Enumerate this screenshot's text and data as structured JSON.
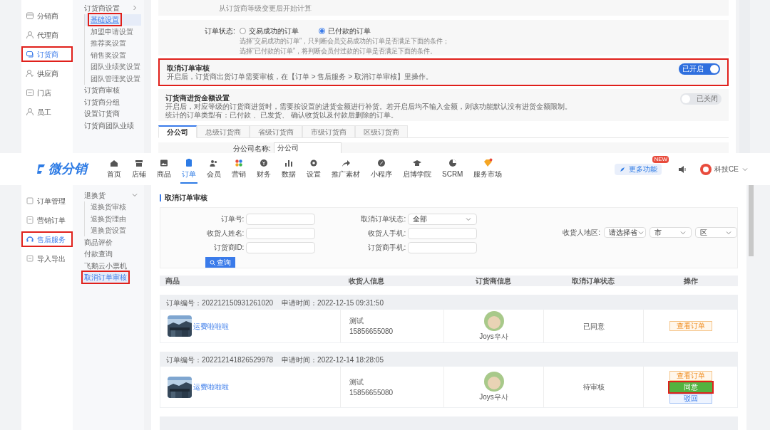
{
  "settings_page": {
    "sidebar": [
      {
        "label": "分销商",
        "selected": false,
        "highlighted": false
      },
      {
        "label": "代理商",
        "selected": false,
        "highlighted": false
      },
      {
        "label": "订货商",
        "selected": true,
        "highlighted": true
      },
      {
        "label": "供应商",
        "selected": false,
        "highlighted": false
      },
      {
        "label": "门店",
        "selected": false,
        "highlighted": false
      },
      {
        "label": "员工",
        "selected": false,
        "highlighted": false
      }
    ],
    "submenu": [
      {
        "label": "订货商设置",
        "expanded": true,
        "children": [
          {
            "label": "基础设置",
            "selected": true,
            "highlighted": true
          },
          {
            "label": "加盟申请设置",
            "selected": false,
            "highlighted": false
          },
          {
            "label": "推荐奖设置",
            "selected": false,
            "highlighted": false
          },
          {
            "label": "销售奖设置",
            "selected": false,
            "highlighted": false
          },
          {
            "label": "团队业绩奖设置",
            "selected": false,
            "highlighted": false
          },
          {
            "label": "团队管理奖设置",
            "selected": false,
            "highlighted": false
          }
        ]
      },
      {
        "label": "订货商审核"
      },
      {
        "label": "订货商分组"
      },
      {
        "label": "设置订货商"
      },
      {
        "label": "订货商团队业绩"
      }
    ],
    "note": "从订货商等级变更后开始计算",
    "order_status": {
      "label": "订单状态:",
      "options": [
        {
          "label": "交易成功的订单",
          "selected": false
        },
        {
          "label": "已付款的订单",
          "selected": true
        }
      ],
      "hints": [
        "选择“交易成功的订单”，只判断会员交易成功的订单是否满足下面的条件；",
        "选择“已付款的订单”，将判断会员付过款的订单是否满足下面的条件。"
      ]
    },
    "toggles": [
      {
        "title": "取消订单审核",
        "description": [
          "开启后，订货商出货订单需要审核，在【订单 > 售后服务 > 取消订单审核】里操作。"
        ],
        "on": true,
        "state_label": "已开启",
        "highlighted": true
      },
      {
        "title": "订货商进货金额设置",
        "description": [
          "开启后，对应等级的订货商进货时，需要按设置的进货金额进行补货。若开启后均不输入金额，则该功能默认没有进货金额限制。",
          "统计的订单类型有：已付款 、已发货、 确认收货以及付款后删除的订单。"
        ],
        "on": false,
        "state_label": "已关闭",
        "highlighted": false
      }
    ],
    "tabs": [
      {
        "label": "分公司",
        "selected": true
      },
      {
        "label": "总级订货商",
        "selected": false
      },
      {
        "label": "省级订货商",
        "selected": false
      },
      {
        "label": "市级订货商",
        "selected": false
      },
      {
        "label": "区级订货商",
        "selected": false
      }
    ],
    "company_name": {
      "label": "分公司名称:",
      "value": "分公司"
    }
  },
  "order_page": {
    "logo": "微分销",
    "nav": [
      {
        "label": "首页",
        "selected": false
      },
      {
        "label": "店铺",
        "selected": false
      },
      {
        "label": "商品",
        "selected": false
      },
      {
        "label": "订单",
        "selected": true
      },
      {
        "label": "会员",
        "selected": false
      },
      {
        "label": "营销",
        "selected": false
      },
      {
        "label": "财务",
        "selected": false
      },
      {
        "label": "数据",
        "selected": false
      },
      {
        "label": "设置",
        "selected": false
      },
      {
        "label": "推广素材",
        "selected": false
      },
      {
        "label": "小程序",
        "selected": false
      },
      {
        "label": "启博学院",
        "selected": false
      },
      {
        "label": "SCRM",
        "selected": false
      },
      {
        "label": "服务市场",
        "selected": false
      }
    ],
    "more": {
      "label": "更多功能",
      "badge": "NEW"
    },
    "user": "科技CE",
    "sidebar": [
      {
        "label": "订单管理",
        "selected": false,
        "highlighted": false
      },
      {
        "label": "营销订单",
        "selected": false,
        "highlighted": false
      },
      {
        "label": "售后服务",
        "selected": true,
        "highlighted": true
      },
      {
        "label": "导入导出",
        "selected": false,
        "highlighted": false
      }
    ],
    "submenu": [
      {
        "label": "退换货",
        "expanded": true,
        "children": [
          {
            "label": "退换货审核",
            "selected": false,
            "highlighted": false
          },
          {
            "label": "退换货理由",
            "selected": false,
            "highlighted": false
          },
          {
            "label": "退换货设置",
            "selected": false,
            "highlighted": false
          }
        ]
      },
      {
        "label": "商品评价",
        "selected": false,
        "highlighted": false
      },
      {
        "label": "付款查询",
        "selected": false,
        "highlighted": false
      },
      {
        "label": "飞鹅云小票机",
        "selected": false,
        "highlighted": false
      },
      {
        "label": "取消订单审核",
        "selected": true,
        "highlighted": true
      }
    ],
    "title": "取消订单审核",
    "filters": [
      [
        {
          "label": "订单号:",
          "kind": "input"
        },
        {
          "label": "收货人姓名:",
          "kind": "input"
        },
        {
          "label": "订货商ID:",
          "kind": "input"
        }
      ],
      [
        {
          "label": "取消订单状态:",
          "kind": "select",
          "value": "全部"
        },
        {
          "label": "收货人手机:",
          "kind": "input"
        },
        {
          "label": "订货商手机:",
          "kind": "input"
        }
      ]
    ],
    "region": {
      "label": "收货人地区:",
      "selects": [
        "请选择省",
        "市",
        "区"
      ]
    },
    "search_button": "查询",
    "table": {
      "columns": [
        "商品",
        "收货人信息",
        "订货商信息",
        "取消订单状态",
        "操作"
      ],
      "orders": [
        {
          "number": "订单编号：202212150931261020",
          "time": "申请时间：2022-12-15 09:31:50",
          "product": "运费啦啦啦",
          "receiver_name": "测试",
          "receiver_phone": "15856655080",
          "supplier": "Joys우사",
          "status": "已同意",
          "actions": [
            {
              "label": "查看订单",
              "kind": "view",
              "highlighted": false
            }
          ]
        },
        {
          "number": "订单编号：202212141826529978",
          "time": "申请时间：2022-12-14 18:28:05",
          "product": "运费啦啦啦",
          "receiver_name": "测试",
          "receiver_phone": "15856655080",
          "supplier": "Joys우사",
          "status": "待审核",
          "actions": [
            {
              "label": "查看订单",
              "kind": "view",
              "highlighted": false
            },
            {
              "label": "同意",
              "kind": "approve",
              "highlighted": true
            },
            {
              "label": "驳回",
              "kind": "reject",
              "highlighted": false
            }
          ]
        }
      ]
    }
  }
}
